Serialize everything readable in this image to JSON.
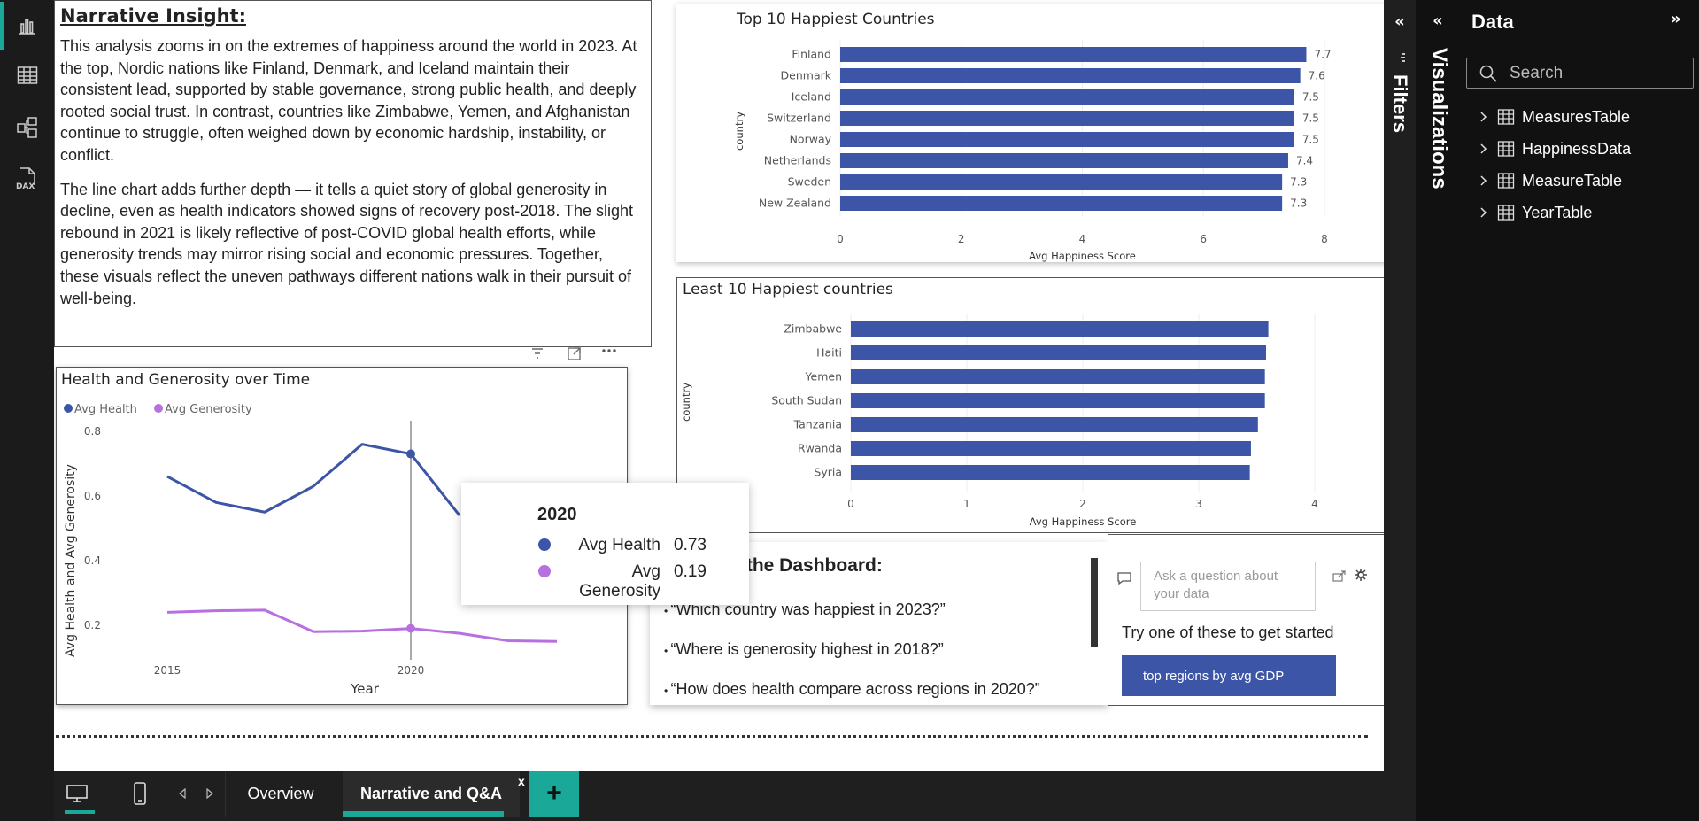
{
  "rail": {
    "icons": [
      "report-view-icon",
      "table-view-icon",
      "model-view-icon",
      "dax-query-icon"
    ],
    "dax_label": "DAX"
  },
  "narrative": {
    "heading": "Narrative Insight:",
    "p1": "This analysis zooms in on the extremes of happiness around the world in 2023. At the top, Nordic nations like Finland, Denmark, and Iceland maintain their consistent lead, supported by stable governance, strong public health, and deeply rooted social trust. In contrast, countries like Zimbabwe, Yemen, and Afghanistan continue to struggle, often weighed down by economic hardship, instability, or conflict.",
    "p2": "The line chart adds further depth — it tells a quiet story of global generosity in decline, even as health indicators showed signs of recovery post-2018. The slight rebound in 2021 is likely reflective of post-COVID global health efforts, while generosity trends may mirror rising social and economic pressures. Together, these visuals reflect the uneven pathways different nations walk in their pursuit of well-being."
  },
  "chart_data": [
    {
      "type": "bar",
      "title": "Top 10 Happiest Countries",
      "xlabel": "Avg Happiness Score",
      "ylabel": "country",
      "categories": [
        "Finland",
        "Denmark",
        "Iceland",
        "Switzerland",
        "Norway",
        "Netherlands",
        "Sweden",
        "New Zealand"
      ],
      "values": [
        7.7,
        7.6,
        7.5,
        7.5,
        7.5,
        7.4,
        7.3,
        7.3
      ],
      "data_labels": [
        "7.7",
        "7.6",
        "7.5",
        "7.5",
        "7.5",
        "7.4",
        "7.3",
        "7.3"
      ],
      "xticks": [
        0,
        2,
        4,
        6,
        8
      ],
      "xlim": [
        0,
        8
      ],
      "color": "#3d55a6"
    },
    {
      "type": "bar",
      "title": "Least 10 Happiest countries",
      "xlabel": "Avg Happiness Score",
      "ylabel": "country",
      "categories": [
        "Zimbabwe",
        "Haiti",
        "Yemen",
        "South Sudan",
        "Tanzania",
        "Rwanda",
        "Syria"
      ],
      "values": [
        3.6,
        3.58,
        3.57,
        3.57,
        3.51,
        3.45,
        3.44
      ],
      "xticks": [
        0,
        1,
        2,
        3,
        4
      ],
      "xlim": [
        0,
        4
      ],
      "color": "#3d55a6"
    },
    {
      "type": "line",
      "title": "Health and Generosity over Time",
      "xlabel": "Year",
      "ylabel": "Avg Health and Avg Generosity",
      "x": [
        2015,
        2016,
        2017,
        2018,
        2019,
        2020,
        2021,
        2022,
        2023
      ],
      "xticks": [
        2015,
        2020
      ],
      "yticks": [
        0.2,
        0.4,
        0.6,
        0.8
      ],
      "ylim": [
        0.13,
        0.8
      ],
      "series": [
        {
          "name": "Avg Health",
          "color": "#3d55a6",
          "values": [
            0.66,
            0.58,
            0.55,
            0.63,
            0.76,
            0.73,
            0.54,
            null,
            null
          ]
        },
        {
          "name": "Avg Generosity",
          "color": "#b86fe0",
          "values": [
            0.24,
            0.245,
            0.247,
            0.18,
            0.182,
            0.19,
            0.175,
            0.152,
            0.15
          ]
        }
      ],
      "tooltip": {
        "year": "2020",
        "rows": [
          {
            "name": "Avg Health",
            "value": "0.73"
          },
          {
            "name": "Avg Generosity",
            "value": "0.19"
          }
        ]
      }
    }
  ],
  "qa_text": {
    "heading": "Asking the Dashboard:",
    "questions": [
      "“Which country was happiest in 2023?”",
      "“Where is generosity highest in 2018?”",
      "“How does health compare across regions in 2020?”"
    ]
  },
  "qa_visual": {
    "placeholder": "Ask a question about your data",
    "hint": "Try one of these to get started",
    "suggestion": "top regions by avg GDP"
  },
  "tabs": {
    "pages": [
      "Overview",
      "Narrative and Q&A"
    ],
    "active": "Narrative and Q&A",
    "close": "x",
    "add": "+"
  },
  "panes": {
    "filters_label": "Filters",
    "visualizations_label": "Visualizations",
    "data_title": "Data",
    "search_placeholder": "Search",
    "tables": [
      "MeasuresTable",
      "HappinessData",
      "MeasureTable",
      "YearTable"
    ]
  },
  "colors": {
    "accent": "#1aa998",
    "bar": "#3d55a6",
    "generosity": "#b86fe0"
  }
}
